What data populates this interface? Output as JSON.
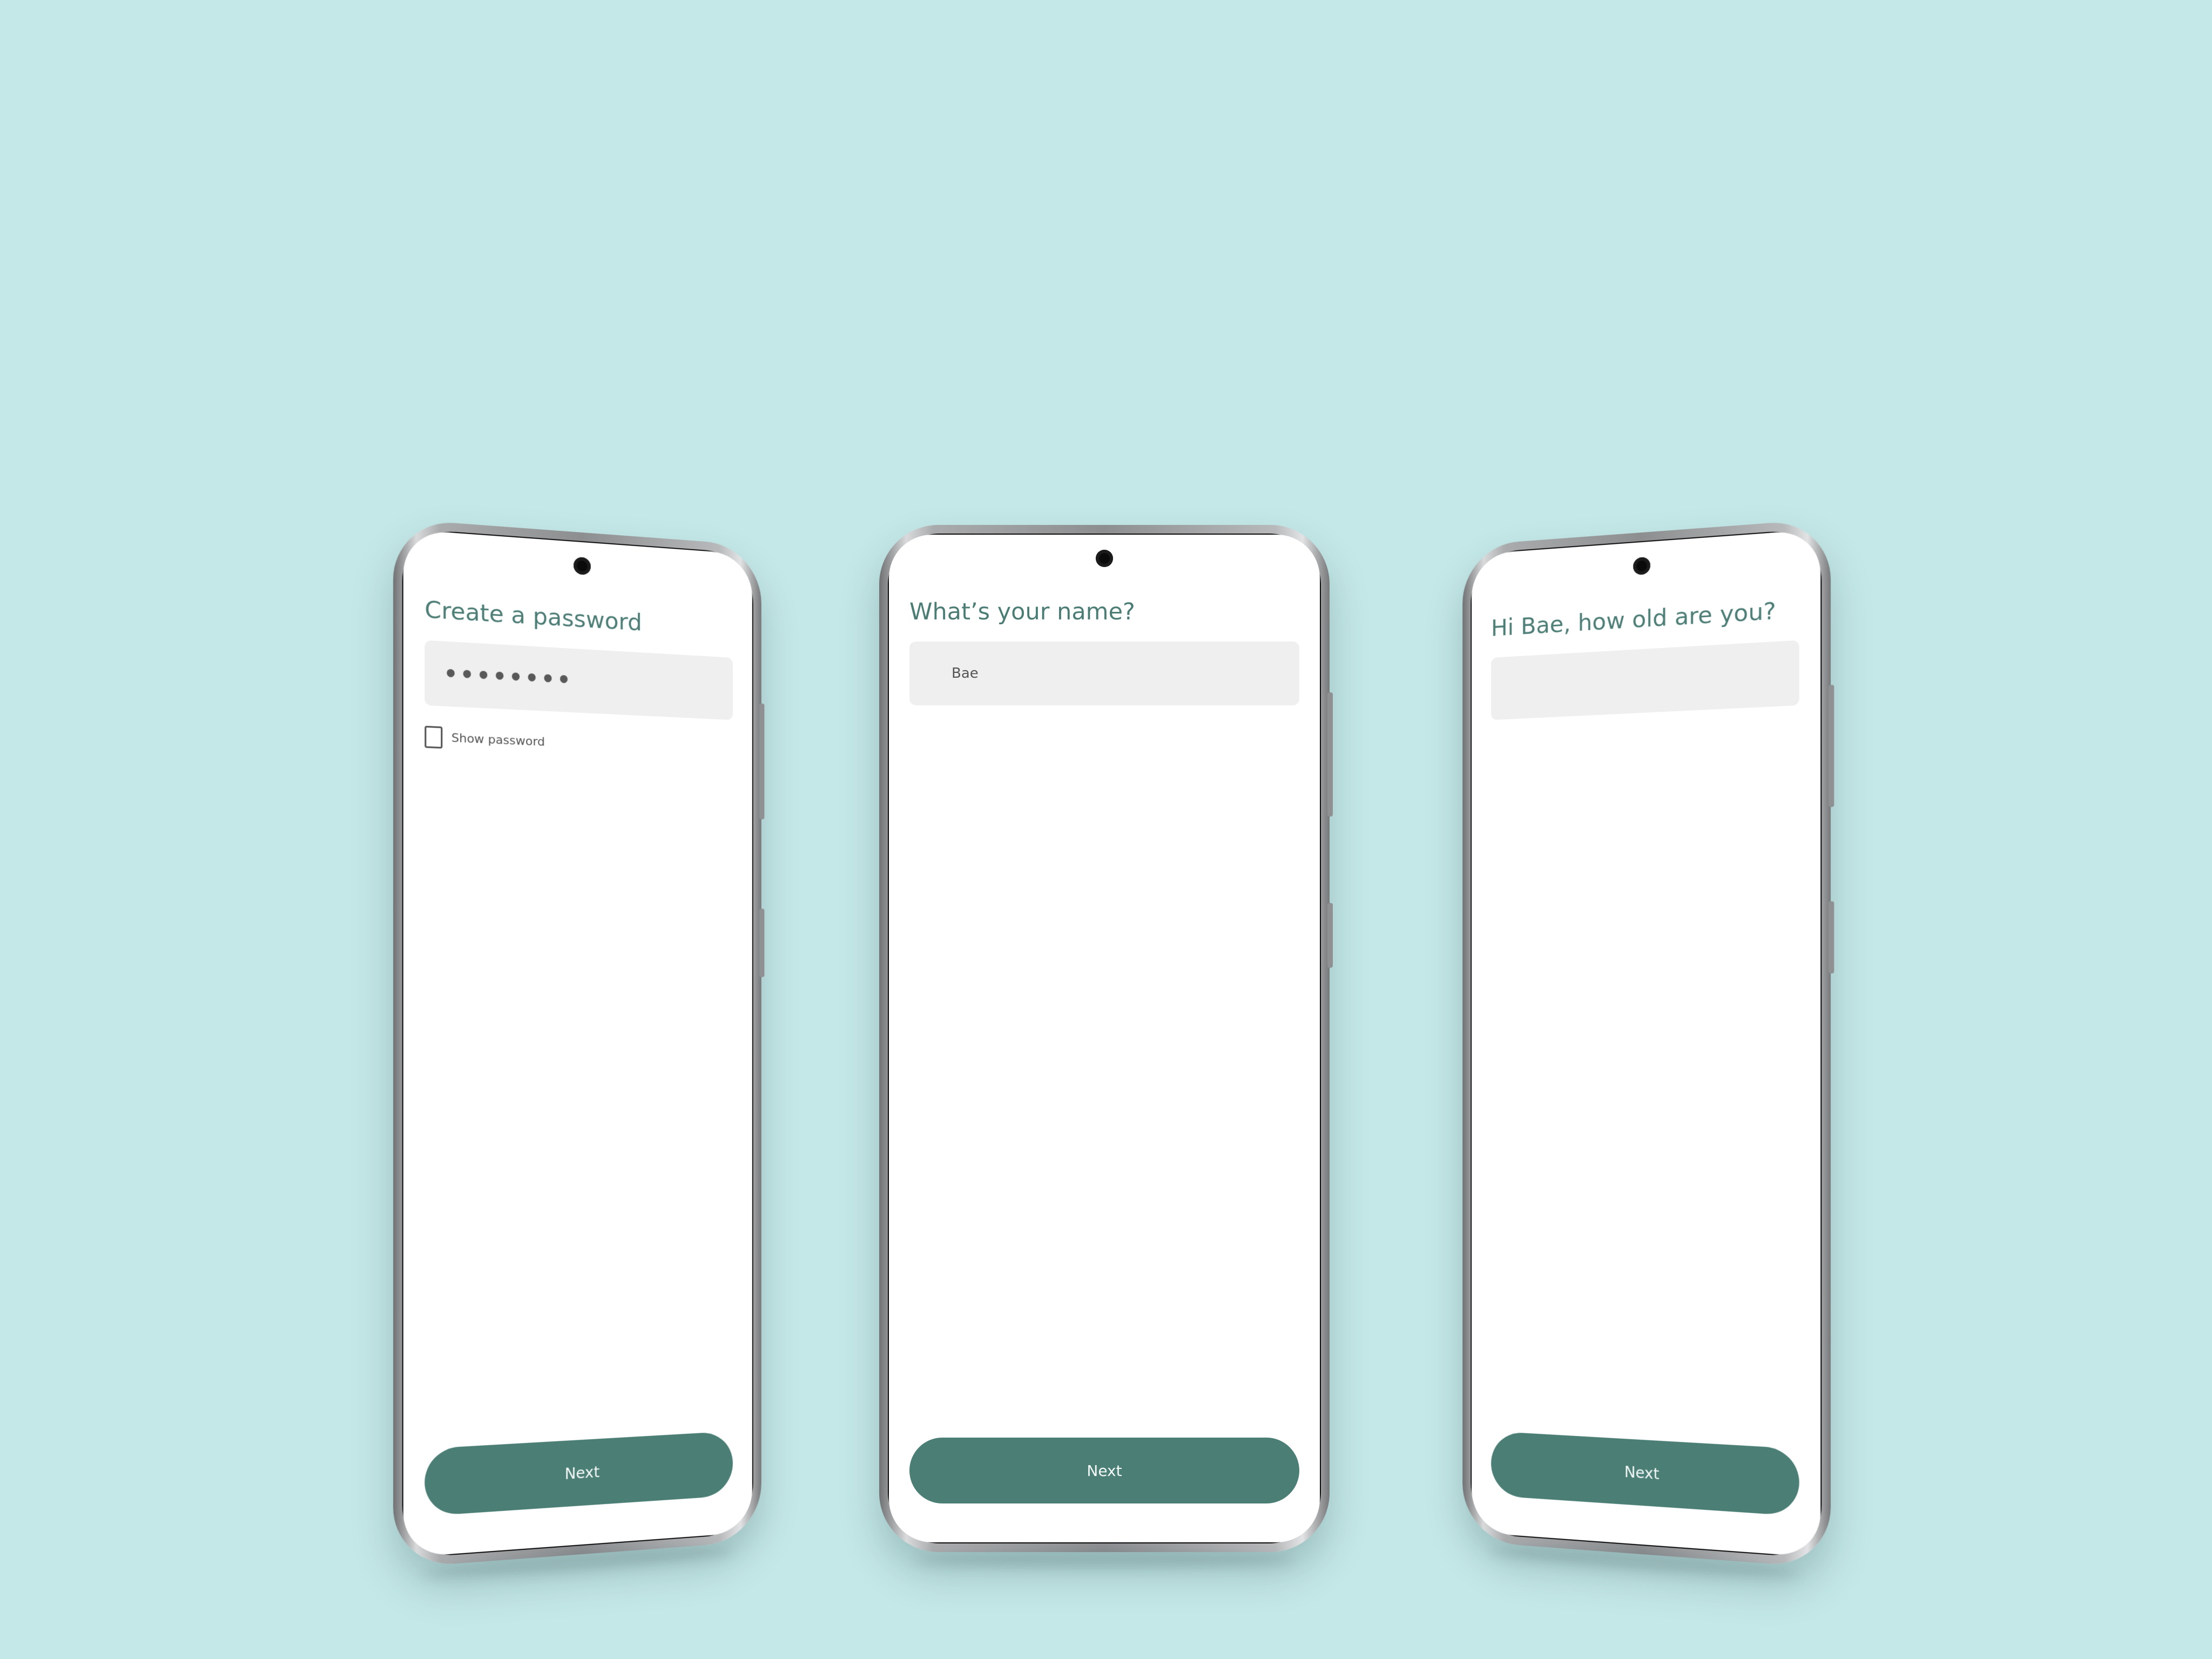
{
  "screens": [
    {
      "title": "Create a password",
      "input_value": "••••••••",
      "checkbox_label": "Show password",
      "button_label": "Next"
    },
    {
      "title": "What’s your name?",
      "input_value": "Bae",
      "button_label": "Next"
    },
    {
      "title": "Hi Bae, how old are you?",
      "input_value": "",
      "button_label": "Next"
    }
  ]
}
